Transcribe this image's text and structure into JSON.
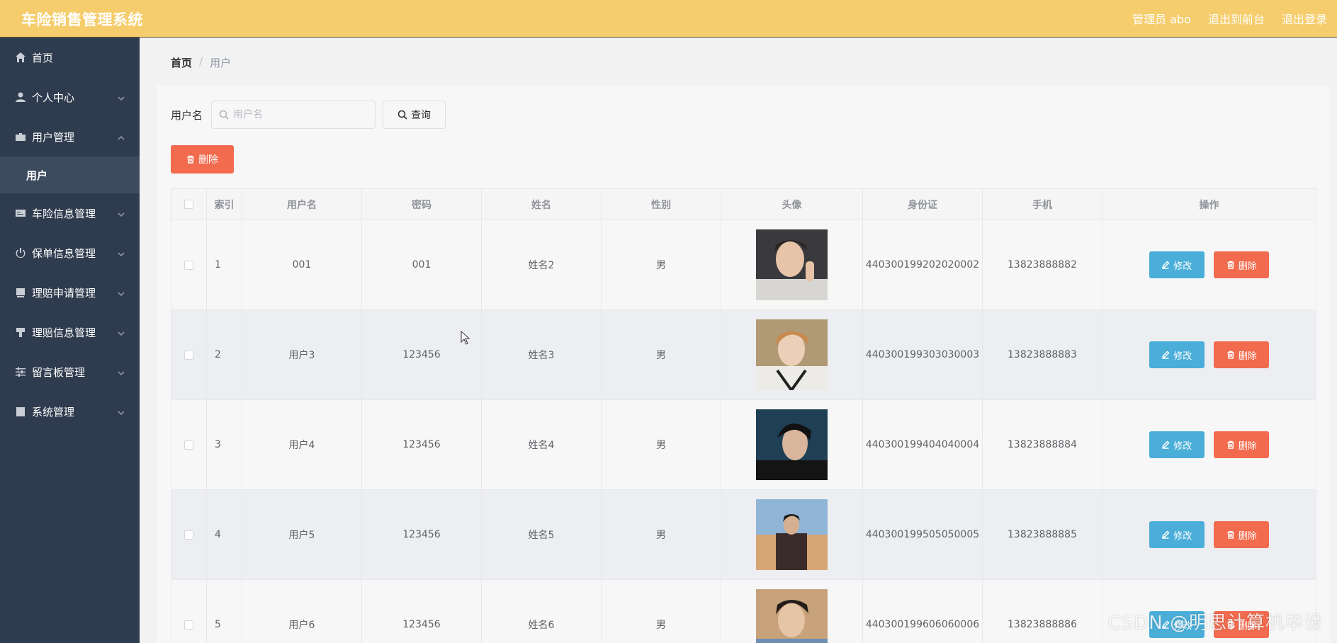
{
  "header": {
    "title": "车险销售管理系统",
    "admin": "管理员 abo",
    "to_front": "退出到前台",
    "logout": "退出登录"
  },
  "sidebar": {
    "items": [
      {
        "label": "首页",
        "icon": "home-icon"
      },
      {
        "label": "个人中心",
        "icon": "user-icon",
        "chevron": "down"
      },
      {
        "label": "用户管理",
        "icon": "folder-icon",
        "chevron": "up",
        "expanded": true,
        "sub": [
          "用户"
        ]
      },
      {
        "label": "车险信息管理",
        "icon": "card-icon",
        "chevron": "down"
      },
      {
        "label": "保单信息管理",
        "icon": "power-icon",
        "chevron": "down"
      },
      {
        "label": "理赔申请管理",
        "icon": "box-icon",
        "chevron": "down"
      },
      {
        "label": "理赔信息管理",
        "icon": "stamp-icon",
        "chevron": "down"
      },
      {
        "label": "留言板管理",
        "icon": "sliders-icon",
        "chevron": "down"
      },
      {
        "label": "系统管理",
        "icon": "trash-box-icon",
        "chevron": "down"
      }
    ]
  },
  "breadcrumb": {
    "home": "首页",
    "sep": "/",
    "current": "用户"
  },
  "search": {
    "label": "用户名",
    "placeholder": "用户名",
    "button": "查询"
  },
  "toolbar": {
    "delete": "删除"
  },
  "table": {
    "columns": [
      "索引",
      "用户名",
      "密码",
      "姓名",
      "性别",
      "头像",
      "身份证",
      "手机",
      "操作"
    ],
    "rows": [
      {
        "index": "1",
        "username": "001",
        "password": "001",
        "name": "姓名2",
        "gender": "男",
        "id_card": "440300199202020002",
        "phone": "13823888882"
      },
      {
        "index": "2",
        "username": "用户3",
        "password": "123456",
        "name": "姓名3",
        "gender": "男",
        "id_card": "440300199303030003",
        "phone": "13823888883"
      },
      {
        "index": "3",
        "username": "用户4",
        "password": "123456",
        "name": "姓名4",
        "gender": "男",
        "id_card": "440300199404040004",
        "phone": "13823888884"
      },
      {
        "index": "4",
        "username": "用户5",
        "password": "123456",
        "name": "姓名5",
        "gender": "男",
        "id_card": "440300199505050005",
        "phone": "13823888885"
      },
      {
        "index": "5",
        "username": "用户6",
        "password": "123456",
        "name": "姓名6",
        "gender": "男",
        "id_card": "440300199606060006",
        "phone": "13823888886"
      }
    ],
    "actions": {
      "edit": "修改",
      "delete": "删除"
    }
  },
  "watermark": "CSDN @明思计算机毕设",
  "colors": {
    "header": "#f5cd6d",
    "sidebar": "#2f3b4e",
    "edit": "#4aaed9",
    "danger": "#f26b4f"
  }
}
